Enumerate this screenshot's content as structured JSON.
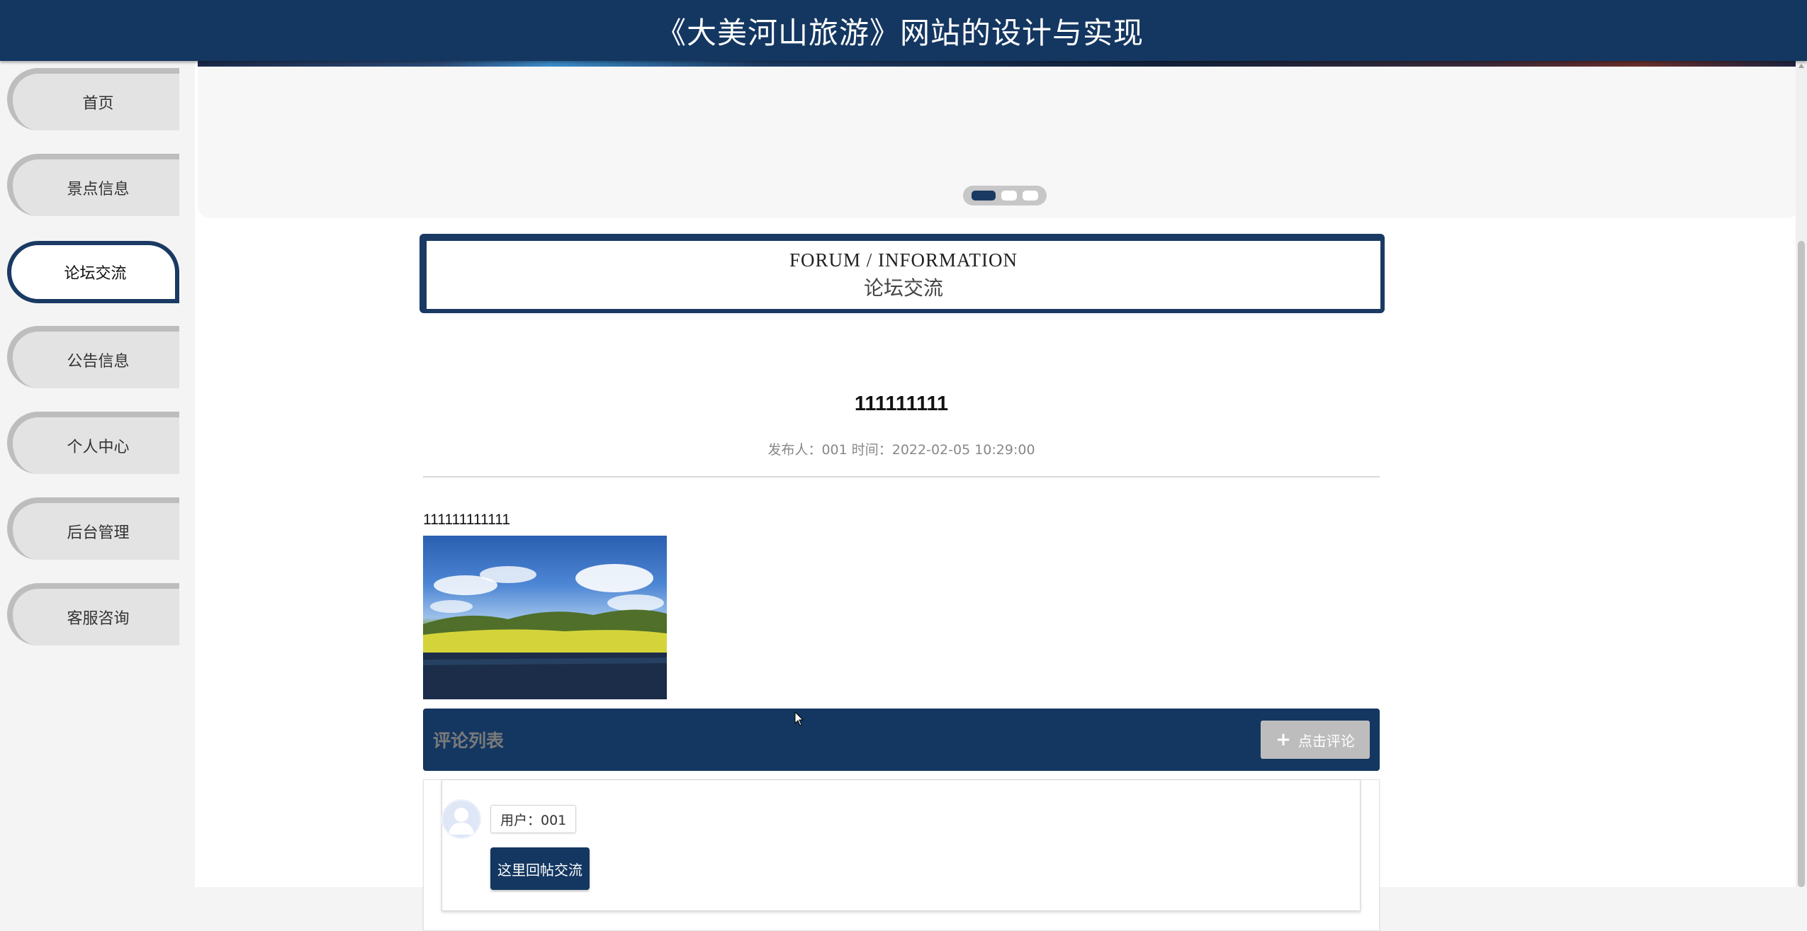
{
  "header": {
    "title": "《大美河山旅游》网站的设计与实现"
  },
  "sidebar": {
    "items": [
      {
        "label": "首页",
        "active": false
      },
      {
        "label": "景点信息",
        "active": false
      },
      {
        "label": "论坛交流",
        "active": true
      },
      {
        "label": "公告信息",
        "active": false
      },
      {
        "label": "个人中心",
        "active": false
      },
      {
        "label": "后台管理",
        "active": false
      },
      {
        "label": "客服咨询",
        "active": false
      }
    ]
  },
  "banner": {
    "slides_total": 3,
    "active_slide": 1
  },
  "section": {
    "title_en": "FORUM / INFORMATION",
    "title_cn": "论坛交流"
  },
  "post": {
    "title": "111111111",
    "meta": "发布人：001 时间：2022-02-05 10:29:00",
    "body": "111111111111",
    "image_icon": "landscape-photo"
  },
  "comments": {
    "header_label": "评论列表",
    "add_button_label": "点击评论",
    "items": [
      {
        "user": "用户：001",
        "content": "这里回帖交流"
      }
    ]
  },
  "colors": {
    "primary": "#143761",
    "page_bg": "#f4f4f4",
    "nav_inactive": "#e3e3e3",
    "button_gray": "#bdbdbd"
  }
}
